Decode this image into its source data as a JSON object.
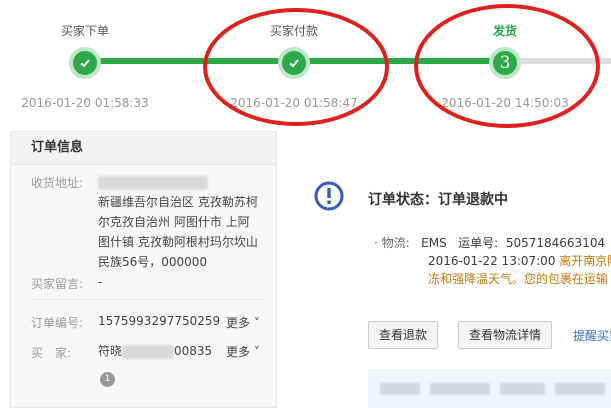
{
  "progress": {
    "steps": [
      {
        "label": "买家下单",
        "time": "2016-01-20 01:58:33",
        "state": "done"
      },
      {
        "label": "买家付款",
        "time": "2016-01-20 01:58:47",
        "state": "done"
      },
      {
        "label": "发货",
        "time": "2016-01-20 14:50:03",
        "state": "active",
        "number": "3"
      }
    ],
    "colors": {
      "done": "#2ea94a",
      "pending": "#dedede",
      "annotation_circle": "#e02020"
    }
  },
  "order_info": {
    "title": "订单信息",
    "address_label": "收货地址:",
    "address_lines": [
      "新疆维吾尔自治区 克孜勒苏柯",
      "尔克孜自治州 阿图什市 上阿",
      "图什镇 克孜勒阿根村玛尔坎山",
      "民族56号，000000"
    ],
    "message_label": "买家留言:",
    "message_value": "-",
    "order_no_label": "订单编号:",
    "order_no_value": "1575993297750259",
    "order_more": "更多",
    "buyer_label": "买　家:",
    "buyer_prefix": "符晓",
    "buyer_suffix": "00835",
    "buyer_more": "更多",
    "badge": "1"
  },
  "status": {
    "text": "订单状态：订单退款中",
    "logistics_label": "· 物流:",
    "logistics_company": "EMS",
    "tracking_label": "运单号:",
    "tracking_no": "5057184663104",
    "update_time": "2016-01-22 13:07:00",
    "update_text": "离开南京陆运",
    "notice": "冻和强降温天气。您的包裹在运输",
    "buttons": {
      "refund": "查看退款",
      "logistics": "查看物流详情"
    },
    "link": "提醒买家"
  }
}
